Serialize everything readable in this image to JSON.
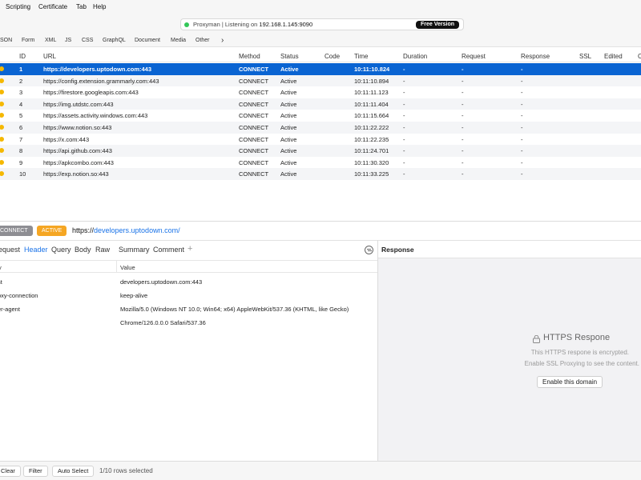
{
  "menu": [
    "Scripting",
    "Certificate",
    "Tab",
    "Help"
  ],
  "status_bar": {
    "prefix": "Proxyman | Listening on ",
    "address": "192.168.1.145:9090",
    "badge": "Free Version"
  },
  "filters": [
    "SON",
    "Form",
    "XML",
    "JS",
    "CSS",
    "GraphQL",
    "Document",
    "Media",
    "Other",
    "›"
  ],
  "table": {
    "columns": [
      "ID",
      "URL",
      "Method",
      "Status",
      "Code",
      "Time",
      "Duration",
      "Request",
      "Response",
      "SSL",
      "Edited",
      "C"
    ],
    "rows": [
      {
        "id": "1",
        "url": "https://developers.uptodown.com:443",
        "method": "CONNECT",
        "status": "Active",
        "code": "",
        "time": "10:11:10.824",
        "duration": "-",
        "request": "-",
        "response": "-",
        "selected": true
      },
      {
        "id": "2",
        "url": "https://config.extension.grammarly.com:443",
        "method": "CONNECT",
        "status": "Active",
        "code": "",
        "time": "10:11:10.894",
        "duration": "-",
        "request": "-",
        "response": "-"
      },
      {
        "id": "3",
        "url": "https://firestore.googleapis.com:443",
        "method": "CONNECT",
        "status": "Active",
        "code": "",
        "time": "10:11:11.123",
        "duration": "-",
        "request": "-",
        "response": "-"
      },
      {
        "id": "4",
        "url": "https://img.utdstc.com:443",
        "method": "CONNECT",
        "status": "Active",
        "code": "",
        "time": "10:11:11.404",
        "duration": "-",
        "request": "-",
        "response": "-"
      },
      {
        "id": "5",
        "url": "https://assets.activity.windows.com:443",
        "method": "CONNECT",
        "status": "Active",
        "code": "",
        "time": "10:11:15.664",
        "duration": "-",
        "request": "-",
        "response": "-"
      },
      {
        "id": "6",
        "url": "https://www.notion.so:443",
        "method": "CONNECT",
        "status": "Active",
        "code": "",
        "time": "10:11:22.222",
        "duration": "-",
        "request": "-",
        "response": "-"
      },
      {
        "id": "7",
        "url": "https://x.com:443",
        "method": "CONNECT",
        "status": "Active",
        "code": "",
        "time": "10:11:22.235",
        "duration": "-",
        "request": "-",
        "response": "-"
      },
      {
        "id": "8",
        "url": "https://api.github.com:443",
        "method": "CONNECT",
        "status": "Active",
        "code": "",
        "time": "10:11:24.701",
        "duration": "-",
        "request": "-",
        "response": "-"
      },
      {
        "id": "9",
        "url": "https://apkcombo.com:443",
        "method": "CONNECT",
        "status": "Active",
        "code": "",
        "time": "10:11:30.320",
        "duration": "-",
        "request": "-",
        "response": "-"
      },
      {
        "id": "10",
        "url": "https://exp.notion.so:443",
        "method": "CONNECT",
        "status": "Active",
        "code": "",
        "time": "10:11:33.225",
        "duration": "-",
        "request": "-",
        "response": "-"
      }
    ]
  },
  "detail": {
    "method_badge": "CONNECT",
    "status_badge": "ACTIVE",
    "url_scheme": "https://",
    "url_host": "developers.uptodown.com/"
  },
  "request_tabs": [
    "equest",
    "Header",
    "Query",
    "Body",
    "Raw",
    "Summary",
    "Comment",
    "+"
  ],
  "kv_header": {
    "key": "y",
    "value": "Value"
  },
  "headers": [
    {
      "key": "st",
      "value": "developers.uptodown.com:443"
    },
    {
      "key": "oxy-connection",
      "value": "keep-alive"
    },
    {
      "key": "er-agent",
      "value": "Mozilla/5.0 (Windows NT 10.0; Win64; x64) AppleWebKit/537.36 (KHTML, like Gecko)"
    },
    {
      "key": "",
      "value": "Chrome/126.0.0.0 Safari/537.36"
    }
  ],
  "response": {
    "header": "Response",
    "title": "HTTPS Respone",
    "desc1": "This HTTPS respone is encrypted.",
    "desc2": "Enable SSL Proxying to see the content.",
    "button": "Enable this domain"
  },
  "bottom": {
    "clear": "Clear",
    "filter": "Filter",
    "auto_select": "Auto Select",
    "status": "1/10 rows selected"
  },
  "colors": {
    "selection": "#0a64d2",
    "active_badge": "#f5a623",
    "method_badge": "#8e8e93",
    "listening_dot": "#34c759",
    "row_dot": "#f5b800"
  }
}
